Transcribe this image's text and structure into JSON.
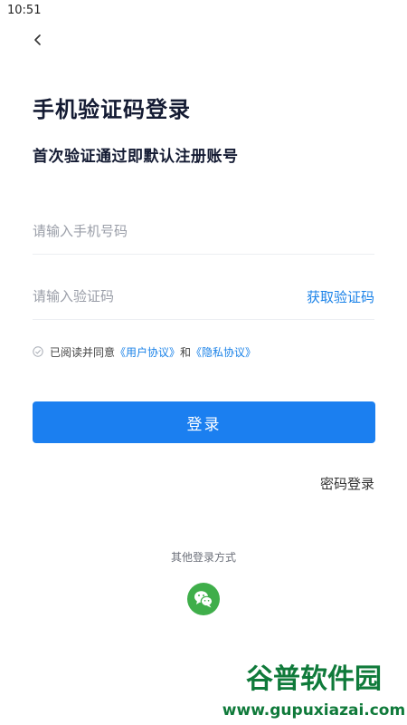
{
  "status_bar": {
    "time": "10:51"
  },
  "header": {
    "title": "手机验证码登录",
    "subtitle": "首次验证通过即默认注册账号"
  },
  "form": {
    "phone_placeholder": "请输入手机号码",
    "phone_value": "",
    "code_placeholder": "请输入验证码",
    "code_value": "",
    "get_code_label": "获取验证码"
  },
  "agreement": {
    "prefix": "已阅读并同意",
    "user_agreement": "《用户协议》",
    "connector": "和",
    "privacy_policy": "《隐私协议》",
    "checked": false
  },
  "login_button": {
    "label": "登录"
  },
  "password_login": {
    "label": "密码登录"
  },
  "other_login": {
    "label": "其他登录方式",
    "methods": [
      "wechat-icon"
    ]
  },
  "watermark": {
    "text_top": "谷普软件园",
    "text_bottom": "www.gupuxiazai.com"
  },
  "colors": {
    "accent": "#1b7ff0",
    "link": "#1a82e8",
    "wechat": "#3fae4a",
    "title": "#141b33"
  },
  "icons": {
    "back": "back-arrow-icon",
    "check": "check-circle-icon",
    "wechat": "wechat-icon"
  }
}
